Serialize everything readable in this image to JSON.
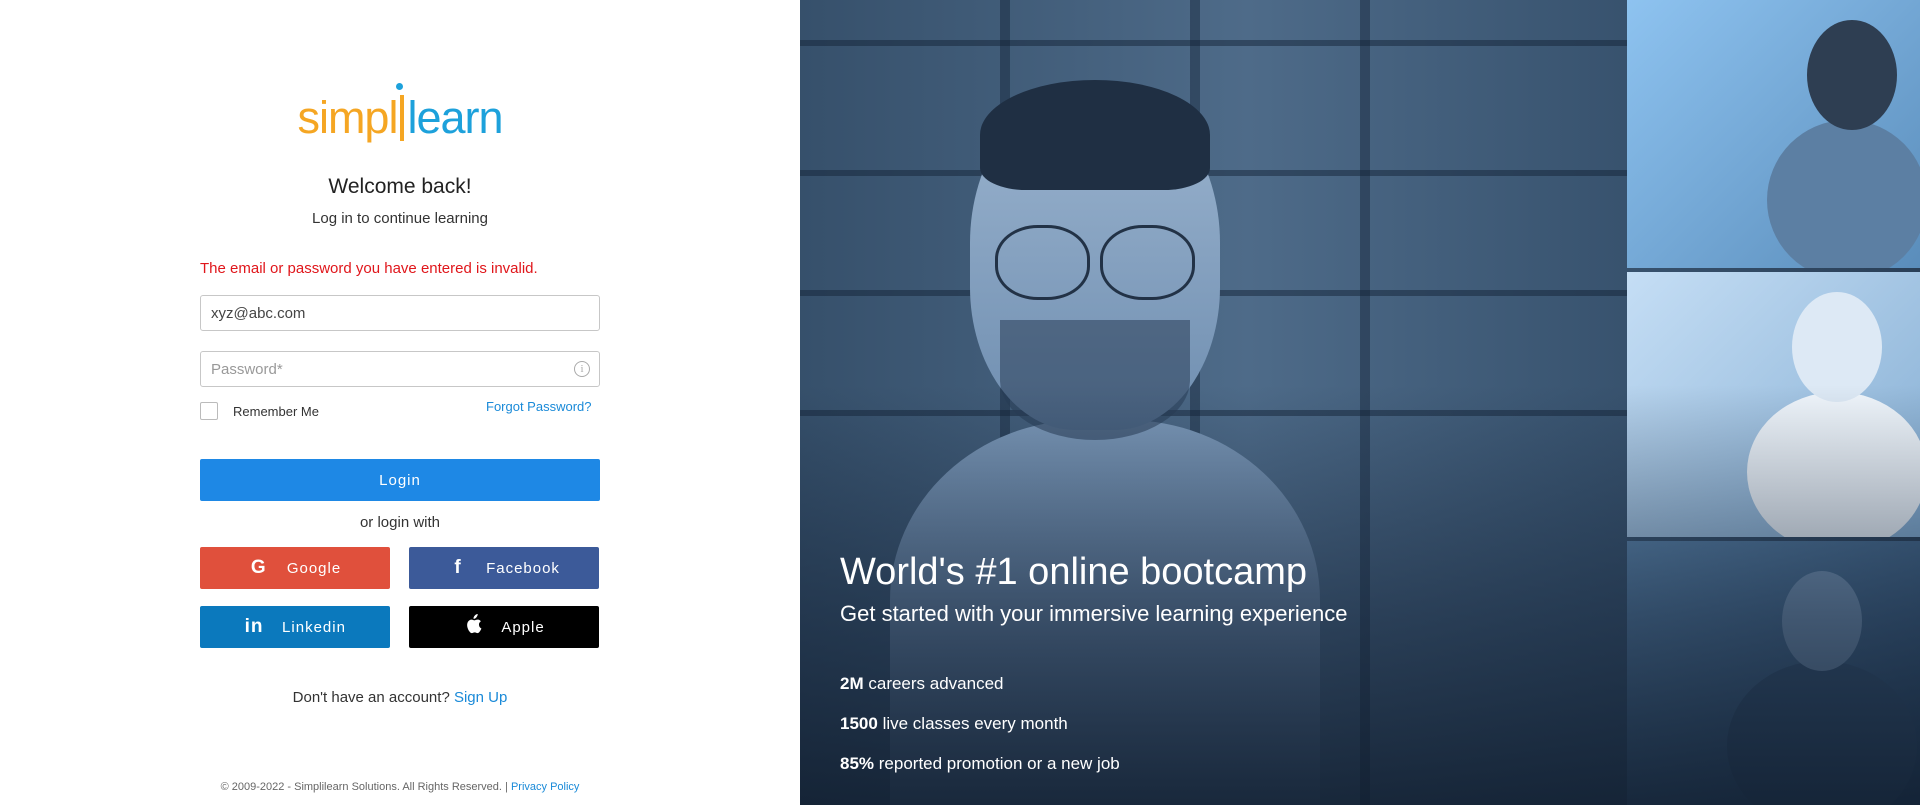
{
  "brand": {
    "logo_part1": "simpl",
    "logo_part2": "learn",
    "primary_color": "#f5a623",
    "secondary_color": "#1da1db"
  },
  "login": {
    "welcome": "Welcome back!",
    "subtitle": "Log in to continue learning",
    "error": "The email or password you have entered is invalid.",
    "email_value": "xyz@abc.com",
    "password_placeholder": "Password*",
    "info_icon": "i",
    "remember_label": "Remember Me",
    "forgot_label": "Forgot Password?",
    "login_label": "Login",
    "or_label": "or login with",
    "error_color": "#e0161b",
    "login_color": "#1e88e5"
  },
  "social": {
    "google": {
      "label": "Google",
      "icon": "G"
    },
    "facebook": {
      "label": "Facebook",
      "icon": "f"
    },
    "linkedin": {
      "label": "Linkedin",
      "icon": "in"
    },
    "apple": {
      "label": "Apple",
      "icon": ""
    }
  },
  "signup": {
    "prompt": "Don't have an account?",
    "link": "Sign Up"
  },
  "footer": {
    "copyright": "© 2009-2022 - Simplilearn Solutions. All Rights Reserved. |",
    "privacy": "Privacy Policy"
  },
  "hero": {
    "title": "World's #1 online bootcamp",
    "subtitle": "Get started with your immersive learning experience",
    "stats": [
      {
        "value": "2M",
        "label": "careers advanced"
      },
      {
        "value": "1500",
        "label": "live classes every month"
      },
      {
        "value": "85%",
        "label": "reported promotion or a new job"
      }
    ]
  }
}
